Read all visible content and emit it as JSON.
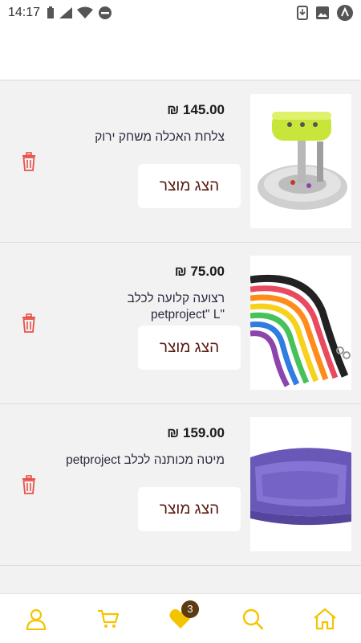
{
  "status_bar": {
    "time": "14:17",
    "icons": [
      "sim-icon",
      "signal-icon",
      "wifi-icon",
      "dnd-icon",
      "download-icon",
      "image-icon",
      "app-icon"
    ]
  },
  "items": [
    {
      "price": "₪ 145.00",
      "name": "צלחת האכלה משחק ירוק",
      "button_label": "הצג מוצר",
      "image": "green-feeder-toy"
    },
    {
      "price": "₪ 75.00",
      "name": "רצועה קלועה לכלב \"petproject\" L",
      "button_label": "הצג מוצר",
      "image": "braided-leash"
    },
    {
      "price": "₪ 159.00",
      "name": "מיטה מכותנה לכלב petproject",
      "button_label": "הצג מוצר",
      "image": "purple-dog-bed"
    }
  ],
  "bottom_nav": {
    "favorites_count": "3",
    "items": [
      "user-icon",
      "cart-icon",
      "heart-icon",
      "search-icon",
      "home-icon"
    ]
  },
  "colors": {
    "accent": "#f5c400",
    "trash": "#e8524a",
    "button_text": "#5a1a10",
    "badge": "#5c3a12"
  }
}
